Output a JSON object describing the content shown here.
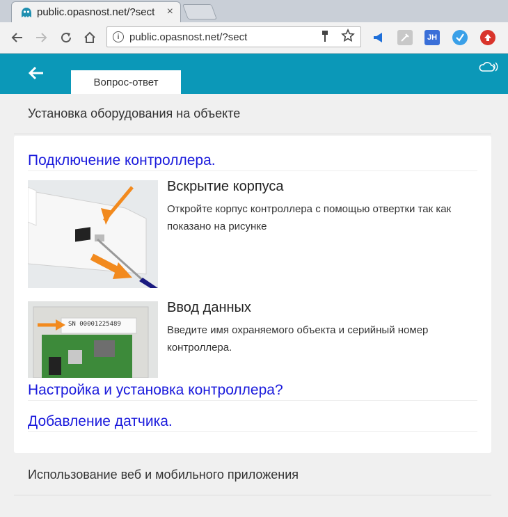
{
  "browser": {
    "tab_title": "public.opasnost.net/?sect",
    "tab_close": "×",
    "url": "public.opasnost.net/?sect",
    "info_glyph": "i",
    "ext_jh": "JH"
  },
  "header": {
    "active_tab": "Вопрос-ответ"
  },
  "sections": {
    "installation": "Установка оборудования на объекте",
    "apps": "Использование веб и мобильного приложения"
  },
  "faq": {
    "controller_connection": "Подключение контроллера.",
    "items": [
      {
        "title": "Вскрытие корпуса",
        "description": "Откройте корпус контроллера с помощью отвертки так как показано на рисунке"
      },
      {
        "title": "Ввод данных",
        "description": "Введите имя охраняемого объекта и серийный номер контроллера."
      }
    ],
    "setup_controller": "Настройка и установка контроллера?",
    "add_sensor": "Добавление датчика.",
    "serial_label": "SN 00001225489"
  },
  "colors": {
    "header_bg": "#0b98b8",
    "link": "#1a1adc",
    "accent_orange": "#f28a1e"
  }
}
